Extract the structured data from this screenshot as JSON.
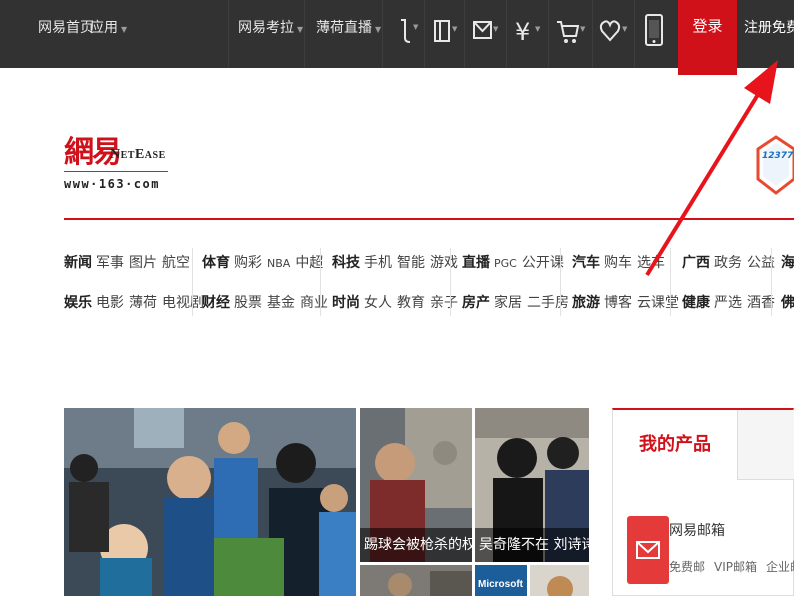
{
  "topbar": {
    "home": "网易首页",
    "apps": "应用",
    "kaola": "网易考拉",
    "live": "薄荷直播",
    "login": "登录",
    "register": "注册免费邮"
  },
  "logo": {
    "cn": "網易",
    "en": "NetEase",
    "url": "www·163·com"
  },
  "badge": {
    "text": "12377"
  },
  "nav": {
    "col1": {
      "row1": {
        "title": "新闻",
        "links": [
          "军事",
          "图片",
          "航空"
        ]
      },
      "row2": {
        "title": "娱乐",
        "links": [
          "电影",
          "薄荷",
          "电视剧"
        ]
      }
    },
    "col2": {
      "row1": {
        "title": "体育",
        "links": [
          "购彩",
          "NBA",
          "中超"
        ]
      },
      "row2": {
        "title": "财经",
        "links": [
          "股票",
          "基金",
          "商业"
        ]
      }
    },
    "col3": {
      "row1": {
        "title": "科技",
        "links": [
          "手机",
          "智能",
          "游戏"
        ]
      },
      "row2": {
        "title": "时尚",
        "links": [
          "女人",
          "教育",
          "亲子"
        ]
      }
    },
    "col4": {
      "row1": {
        "title": "直播",
        "links": [
          "PGC",
          "公开课"
        ]
      },
      "row2": {
        "title": "房产",
        "links": [
          "家居",
          "二手房"
        ]
      }
    },
    "col5": {
      "row1": {
        "title": "汽车",
        "links": [
          "购车",
          "选车"
        ]
      },
      "row2": {
        "title": "旅游",
        "links": [
          "博客",
          "云课堂"
        ]
      }
    },
    "col6": {
      "row1": {
        "title": "广西",
        "links": [
          "政务",
          "公益"
        ]
      },
      "row2": {
        "title": "健康",
        "links": [
          "严选",
          "酒香"
        ]
      }
    },
    "col7": {
      "row1": {
        "title": "海",
        "links": []
      },
      "row2": {
        "title": "佛",
        "links": []
      }
    }
  },
  "news": {
    "caption1": "踢球会被枪杀的权利",
    "caption2": "吴奇隆不在 刘诗诗提",
    "logo_text": "Microsoft"
  },
  "products": {
    "tab_label": "我的产品",
    "mail_title": "网易邮箱",
    "mail_links": [
      "免费邮",
      "VIP邮箱",
      "企业邮"
    ]
  },
  "colors": {
    "brand_red": "#d0111a",
    "topbar_bg": "#323232"
  }
}
